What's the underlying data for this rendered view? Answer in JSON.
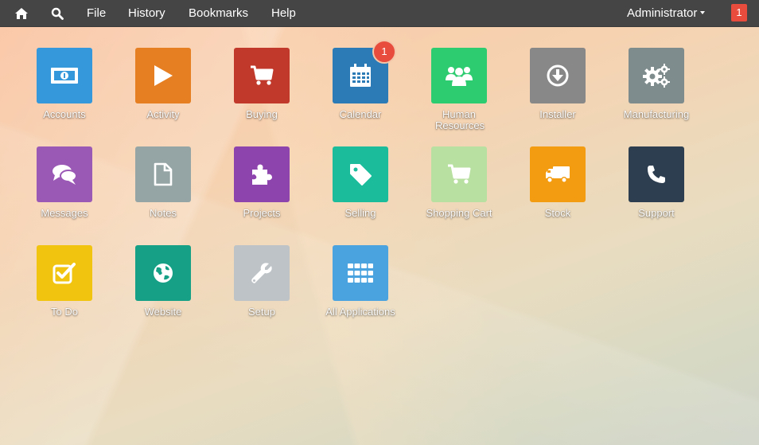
{
  "navbar": {
    "home_icon": "home-icon",
    "search_icon": "search-icon",
    "menus": [
      "File",
      "History",
      "Bookmarks",
      "Help"
    ],
    "user": "Administrator",
    "notification_count": "1"
  },
  "apps": [
    {
      "label": "Accounts",
      "icon": "money-icon",
      "color": "#3498db"
    },
    {
      "label": "Activity",
      "icon": "play-icon",
      "color": "#e67e22"
    },
    {
      "label": "Buying",
      "icon": "cart-icon",
      "color": "#c0392b"
    },
    {
      "label": "Calendar",
      "icon": "calendar-icon",
      "color": "#2c7bb6",
      "badge": "1"
    },
    {
      "label": "Human Resources",
      "icon": "group-icon",
      "color": "#2ecc71"
    },
    {
      "label": "Installer",
      "icon": "download-icon",
      "color": "#888888"
    },
    {
      "label": "Manufacturing",
      "icon": "gears-icon",
      "color": "#7f8c8d"
    },
    {
      "label": "Messages",
      "icon": "comments-icon",
      "color": "#9b59b6"
    },
    {
      "label": "Notes",
      "icon": "file-icon",
      "color": "#95a5a6"
    },
    {
      "label": "Projects",
      "icon": "puzzle-icon",
      "color": "#8e44ad"
    },
    {
      "label": "Selling",
      "icon": "tag-icon",
      "color": "#1abc9c"
    },
    {
      "label": "Shopping Cart",
      "icon": "cart-icon",
      "color": "#b8e0a0"
    },
    {
      "label": "Stock",
      "icon": "truck-icon",
      "color": "#f39c12"
    },
    {
      "label": "Support",
      "icon": "phone-icon",
      "color": "#2c3e50"
    },
    {
      "label": "To Do",
      "icon": "check-icon",
      "color": "#f1c40f"
    },
    {
      "label": "Website",
      "icon": "globe-icon",
      "color": "#16a085"
    },
    {
      "label": "Setup",
      "icon": "wrench-icon",
      "color": "#bdc3c7"
    },
    {
      "label": "All Applications",
      "icon": "grid-icon",
      "color": "#4aa3df"
    }
  ]
}
